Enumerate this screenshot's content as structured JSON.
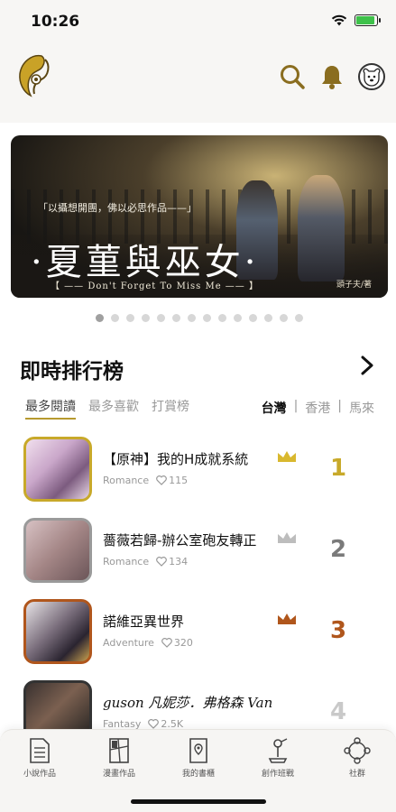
{
  "status_bar": {
    "time": "10:26"
  },
  "banner": {
    "tagline": "「以攝想開團，佛以必思作品——」",
    "title": "·夏菫與巫女·",
    "subtitle": "【 —— Don't Forget To Miss Me —— 】",
    "author": "頭子夫/著"
  },
  "carousel": {
    "count": 14,
    "active_index": 0
  },
  "section": {
    "title": "即時排行榜",
    "tabs": [
      "最多閱讀",
      "最多喜歡",
      "打賞榜"
    ],
    "active_tab": 0,
    "regions": [
      "台灣",
      "香港",
      "馬來"
    ],
    "separator": "|",
    "active_region": 0
  },
  "ranking": [
    {
      "rank": "1",
      "title": "【原神】我的H成就系統",
      "genre": "Romance",
      "likes": "115",
      "rank_color": "#c8a92a",
      "crown_color": "#d9b82e",
      "cover_border": "#c8a92a"
    },
    {
      "rank": "2",
      "title": "薔薇若歸-辦公室砲友轉正",
      "genre": "Romance",
      "likes": "134",
      "rank_color": "#7a7a7a",
      "crown_color": "#bdbdbd",
      "cover_border": "#9a9a9a"
    },
    {
      "rank": "3",
      "title": "諾維亞異世界",
      "genre": "Adventure",
      "likes": "320",
      "rank_color": "#b0561c",
      "crown_color": "#b0561c",
      "cover_border": "#b0561c"
    },
    {
      "rank": "4",
      "title": "guson 凡妮莎．弗格森 Van",
      "genre": "Fantasy",
      "likes": "2.5K",
      "rank_color": "#c9c9c9",
      "crown_color": "",
      "cover_border": "#333333"
    }
  ],
  "tabbar": {
    "items": [
      {
        "label": "小說作品",
        "icon": "document-icon"
      },
      {
        "label": "漫畫作品",
        "icon": "comic-icon"
      },
      {
        "label": "我的書櫃",
        "icon": "bookshelf-icon"
      },
      {
        "label": "創作班戰",
        "icon": "creator-icon"
      },
      {
        "label": "社群",
        "icon": "community-icon"
      }
    ]
  },
  "colors": {
    "accent": "#b79a2f",
    "icon_gold": "#8a6d1f"
  }
}
